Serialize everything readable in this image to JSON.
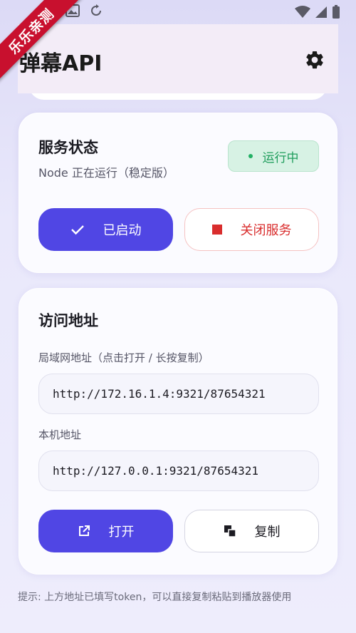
{
  "ribbon": {
    "label": "乐乐亲测"
  },
  "app_bar": {
    "title": "弹幕API",
    "settings_icon": "gear-icon"
  },
  "service_card": {
    "title": "服务状态",
    "subtitle": "Node 正在运行（稳定版）",
    "status_badge": "运行中",
    "start_button": "已启动",
    "stop_button": "关闭服务"
  },
  "access_card": {
    "title": "访问地址",
    "lan_label": "局域网地址（点击打开 / 长按复制）",
    "lan_url": "http://172.16.1.4:9321/87654321",
    "local_label": "本机地址",
    "local_url": "http://127.0.0.1:9321/87654321",
    "open_button": "打开",
    "copy_button": "复制"
  },
  "tip": "提示: 上方地址已填写token，可以直接复制粘贴到播放器使用",
  "colors": {
    "primary": "#5046e4",
    "danger": "#d92d2d",
    "success": "#1f9d5c",
    "ribbon": "#c8102e"
  }
}
